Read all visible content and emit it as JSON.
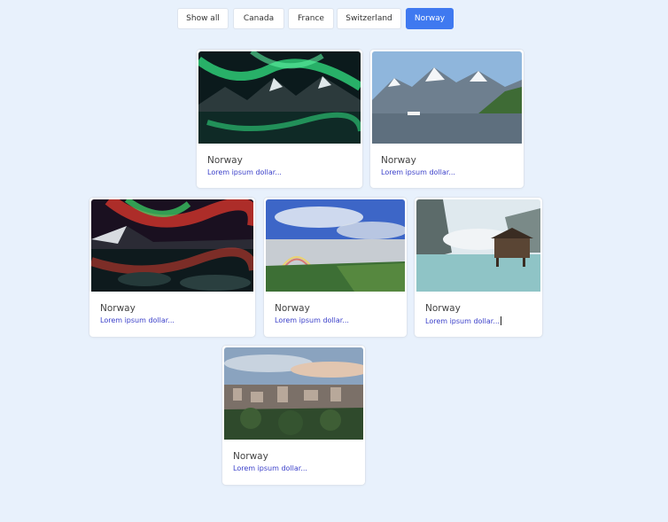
{
  "filters": [
    {
      "label": "Show all",
      "active": false
    },
    {
      "label": "Canada",
      "active": false
    },
    {
      "label": "France",
      "active": false
    },
    {
      "label": "Switzerland",
      "active": false
    },
    {
      "label": "Norway",
      "active": true
    }
  ],
  "cards": [
    {
      "title": "Norway",
      "desc": "Lorem ipsum dollar...",
      "image": "aurora-mountains"
    },
    {
      "title": "Norway",
      "desc": "Lorem ipsum dollar...",
      "image": "snowy-fjord"
    },
    {
      "title": "Norway",
      "desc": "Lorem ipsum dollar...",
      "image": "red-aurora-lake"
    },
    {
      "title": "Norway",
      "desc": "Lorem ipsum dollar...",
      "image": "waterfall-rainbow"
    },
    {
      "title": "Norway",
      "desc": "Lorem ipsum dollar...",
      "image": "lake-cabin"
    },
    {
      "title": "Norway",
      "desc": "Lorem ipsum dollar...",
      "image": "city-view"
    }
  ],
  "colors": {
    "accent": "#3f79f0",
    "background": "#e8f1fc",
    "desc": "#3a3fc9"
  }
}
